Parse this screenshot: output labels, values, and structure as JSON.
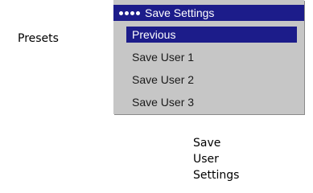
{
  "side_label": "Presets",
  "menu": {
    "title": "Save Settings",
    "items": [
      {
        "label": "Previous",
        "selected": true
      },
      {
        "label": "Save User 1",
        "selected": false
      },
      {
        "label": "Save User 2",
        "selected": false
      },
      {
        "label": "Save User 3",
        "selected": false
      }
    ]
  },
  "caption": {
    "lines": [
      "Save",
      "User",
      "Settings"
    ]
  },
  "colors": {
    "highlight": "#1c1c8a",
    "menu_background": "#c6c6c6"
  }
}
